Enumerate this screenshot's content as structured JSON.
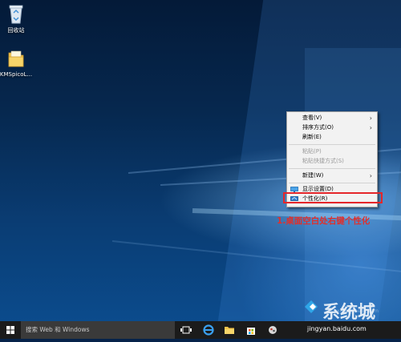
{
  "desktop": {
    "icons": [
      {
        "label": "回收站",
        "icon": "recycle-bin-icon"
      },
      {
        "label": "KMSpicoL...",
        "icon": "folder-icon"
      }
    ]
  },
  "context_menu": {
    "items": [
      {
        "label": "查看(V)",
        "submenu": true
      },
      {
        "label": "排序方式(O)",
        "submenu": true
      },
      {
        "label": "刷新(E)"
      },
      {
        "label": "粘贴(P)",
        "disabled": true
      },
      {
        "label": "粘贴快捷方式(S)",
        "disabled": true
      },
      {
        "label": "新建(W)",
        "submenu": true
      },
      {
        "label": "显示设置(D)",
        "icon": "display-icon"
      },
      {
        "label": "个性化(R)",
        "icon": "personalize-icon"
      }
    ]
  },
  "annotation": {
    "text": "1.桌面空白处右键个性化",
    "color": "#e0302c"
  },
  "taskbar": {
    "search_placeholder": "搜索 Web 和 Windows",
    "pinned": [
      "task-view-icon",
      "edge-icon",
      "file-explorer-icon",
      "store-icon",
      "app-icon"
    ]
  },
  "watermark": {
    "logo": "系统城",
    "url": "jingyan.baidu.com",
    "sub": "xitongcheng.com"
  }
}
